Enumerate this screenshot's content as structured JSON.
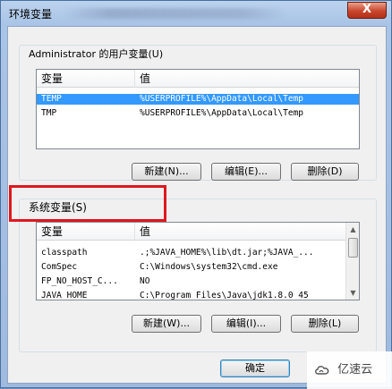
{
  "window": {
    "title": "环境变量",
    "close_label": "X"
  },
  "user_vars": {
    "title": "Administrator 的用户变量(U)",
    "columns": [
      "变量",
      "值"
    ],
    "rows": [
      {
        "name": "TEMP",
        "value": "%USERPROFILE%\\AppData\\Local\\Temp",
        "selected": true
      },
      {
        "name": "TMP",
        "value": "%USERPROFILE%\\AppData\\Local\\Temp",
        "selected": false
      }
    ],
    "buttons": {
      "new": "新建(N)...",
      "edit": "编辑(E)...",
      "delete": "删除(D)"
    }
  },
  "system_vars": {
    "title": "系统变量(S)",
    "columns": [
      "变量",
      "值"
    ],
    "rows": [
      {
        "name": "classpath",
        "value": ".;%JAVA_HOME%\\lib\\dt.jar;%JAVA_..."
      },
      {
        "name": "ComSpec",
        "value": "C:\\Windows\\system32\\cmd.exe"
      },
      {
        "name": "FP_NO_HOST_C...",
        "value": "NO"
      },
      {
        "name": "JAVA_HOME",
        "value": "C:\\Program Files\\Java\\jdk1.8.0_45"
      }
    ],
    "buttons": {
      "new": "新建(W)...",
      "edit": "编辑(I)...",
      "delete": "删除(L)"
    }
  },
  "footer": {
    "ok": "确定"
  },
  "watermark": {
    "text": "亿速云"
  },
  "colors": {
    "selection": "#3399ff",
    "highlight_box": "#e0171f",
    "close_button": "#c9462c"
  }
}
